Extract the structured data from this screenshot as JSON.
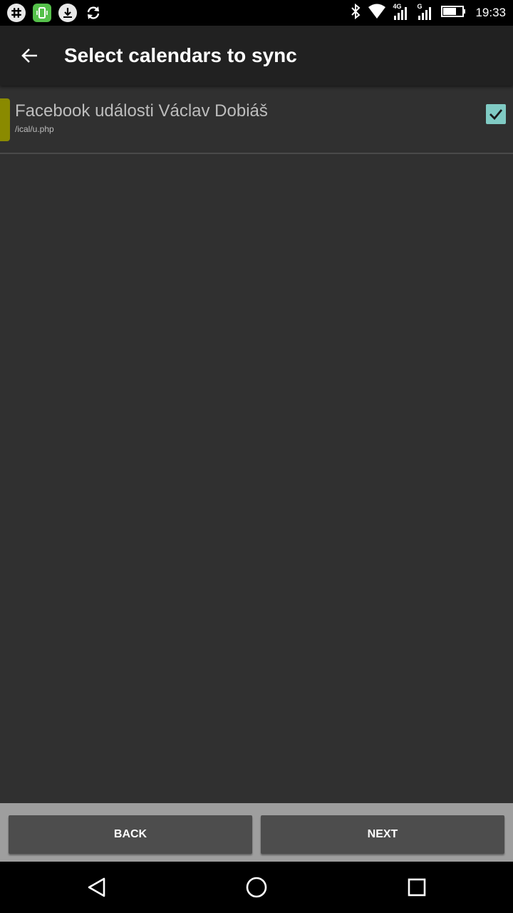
{
  "status_bar": {
    "time": "19:33",
    "notification_icons": [
      "slack-icon",
      "vibe-app-icon",
      "download-icon",
      "sync-icon"
    ],
    "system_icons": [
      "bluetooth-icon",
      "wifi-icon",
      "signal-4g-icon",
      "signal-icon",
      "battery-icon"
    ],
    "network_label_1": "4G",
    "network_label_2": "G"
  },
  "app_bar": {
    "title": "Select calendars to sync",
    "back_icon": "arrow-back-icon"
  },
  "calendars": [
    {
      "name": "Facebook události Václav Dobiáš",
      "url": "/ical/u.php",
      "color": "#8a8a00",
      "checked": true
    }
  ],
  "buttons": {
    "back_label": "BACK",
    "next_label": "NEXT"
  },
  "nav_bar": {
    "icons": [
      "nav-back-icon",
      "nav-home-icon",
      "nav-recents-icon"
    ]
  },
  "colors": {
    "background": "#303030",
    "app_bar": "#212121",
    "checkbox_accent": "#80cbc4",
    "button": "#4d4d4d"
  }
}
